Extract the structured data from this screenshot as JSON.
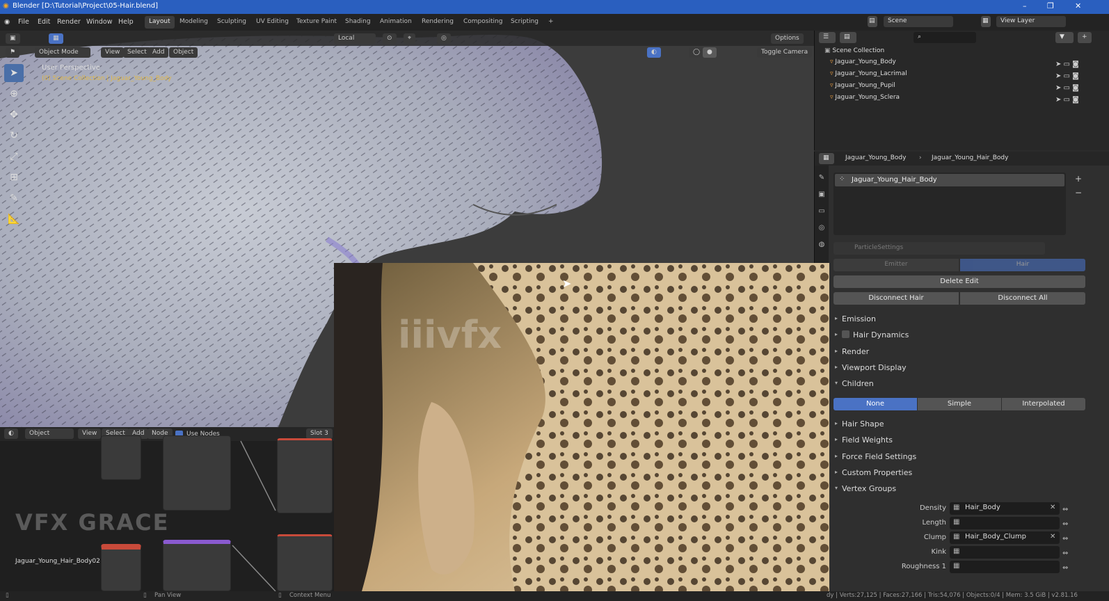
{
  "window": {
    "title": "Blender [D:\\Tutorial\\Project\\05-Hair.blend]",
    "controls": [
      "–",
      "❐",
      "✕"
    ]
  },
  "menu": [
    "File",
    "Edit",
    "Render",
    "Window",
    "Help"
  ],
  "workspaces": [
    "Layout",
    "Modeling",
    "Sculpting",
    "UV Editing",
    "Texture Paint",
    "Shading",
    "Animation",
    "Rendering",
    "Compositing",
    "Scripting",
    "+"
  ],
  "scene": {
    "name": "Scene",
    "view_layer": "View Layer"
  },
  "viewport": {
    "mode": "Object Mode",
    "menus": [
      "View",
      "Select",
      "Add",
      "Object"
    ],
    "transform": "Local",
    "options": "Options",
    "toggle_camera": "Toggle Camera",
    "perspective": "User Perspective",
    "collection_info": "(0) Scene Collection | Jaguar_Young_Body"
  },
  "outliner": {
    "root": "Scene Collection",
    "items": [
      "Jaguar_Young_Body",
      "Jaguar_Young_Lacrimal",
      "Jaguar_Young_Pupil",
      "Jaguar_Young_Sclera"
    ]
  },
  "properties": {
    "breadcrumb": [
      "Jaguar_Young_Body",
      "Jaguar_Young_Hair_Body"
    ],
    "particle_system": "Jaguar_Young_Hair_Body",
    "settings_name": "ParticleSettings",
    "type_options": [
      "Emitter",
      "Hair"
    ],
    "delete_edit": "Delete Edit",
    "disconnect_hair": "Disconnect Hair",
    "disconnect_all": "Disconnect All",
    "panels_top": [
      "Emission",
      "Hair Dynamics",
      "Render",
      "Viewport Display",
      "Children"
    ],
    "children_options": [
      "None",
      "Simple",
      "Interpolated"
    ],
    "panels_bottom": [
      "Hair Shape",
      "Field Weights",
      "Force Field Settings",
      "Custom Properties",
      "Vertex Groups"
    ],
    "vertex_groups": [
      {
        "label": "Density",
        "value": "Hair_Body"
      },
      {
        "label": "Length",
        "value": ""
      },
      {
        "label": "Clump",
        "value": "Hair_Body_Clump"
      },
      {
        "label": "Kink",
        "value": ""
      },
      {
        "label": "Roughness 1",
        "value": ""
      }
    ]
  },
  "node_editor": {
    "type": "Object",
    "menus": [
      "View",
      "Select",
      "Add",
      "Node"
    ],
    "use_nodes": "Use Nodes",
    "slot": "Slot 3",
    "material_name": "Jaguar_Young_Hair_Body02"
  },
  "watermarks": {
    "center": "iiivfx",
    "logo": "VFX GRACE"
  },
  "status": {
    "left": "Pan View",
    "middle": "Context Menu",
    "right": "dy | Verts:27,125 | Faces:27,166 | Tris:54,076 | Objects:0/4 | Mem: 3.5 GiB | v2.81.16"
  },
  "colors": {
    "accent": "#4a72c4",
    "title_bar": "#2a5fbf",
    "active_tool": "#4a6fa8"
  }
}
